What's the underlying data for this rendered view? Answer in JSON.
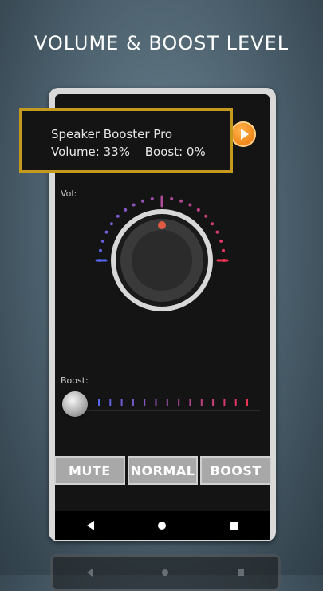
{
  "headline": "VOLUME & BOOST LEVEL",
  "notification": {
    "app_name": "Speaker Booster Pro",
    "volume_text": "Volume: 33%",
    "boost_text": "Boost: 0%"
  },
  "volume": {
    "label": "Vol:",
    "level_percent": 33
  },
  "boost": {
    "label": "Boost:",
    "level_percent": 0
  },
  "buttons": {
    "mute": "MUTE",
    "normal": "NORMAL",
    "boost": "BOOST"
  },
  "icons": {
    "play": "play-icon",
    "back": "back-icon",
    "home": "home-icon",
    "recent": "recent-apps-icon"
  },
  "colors": {
    "accent_orange": "#f08a1c",
    "frame_gold": "#c49a1e",
    "dial_blue": "#5566ee",
    "dial_red": "#ee3355"
  }
}
